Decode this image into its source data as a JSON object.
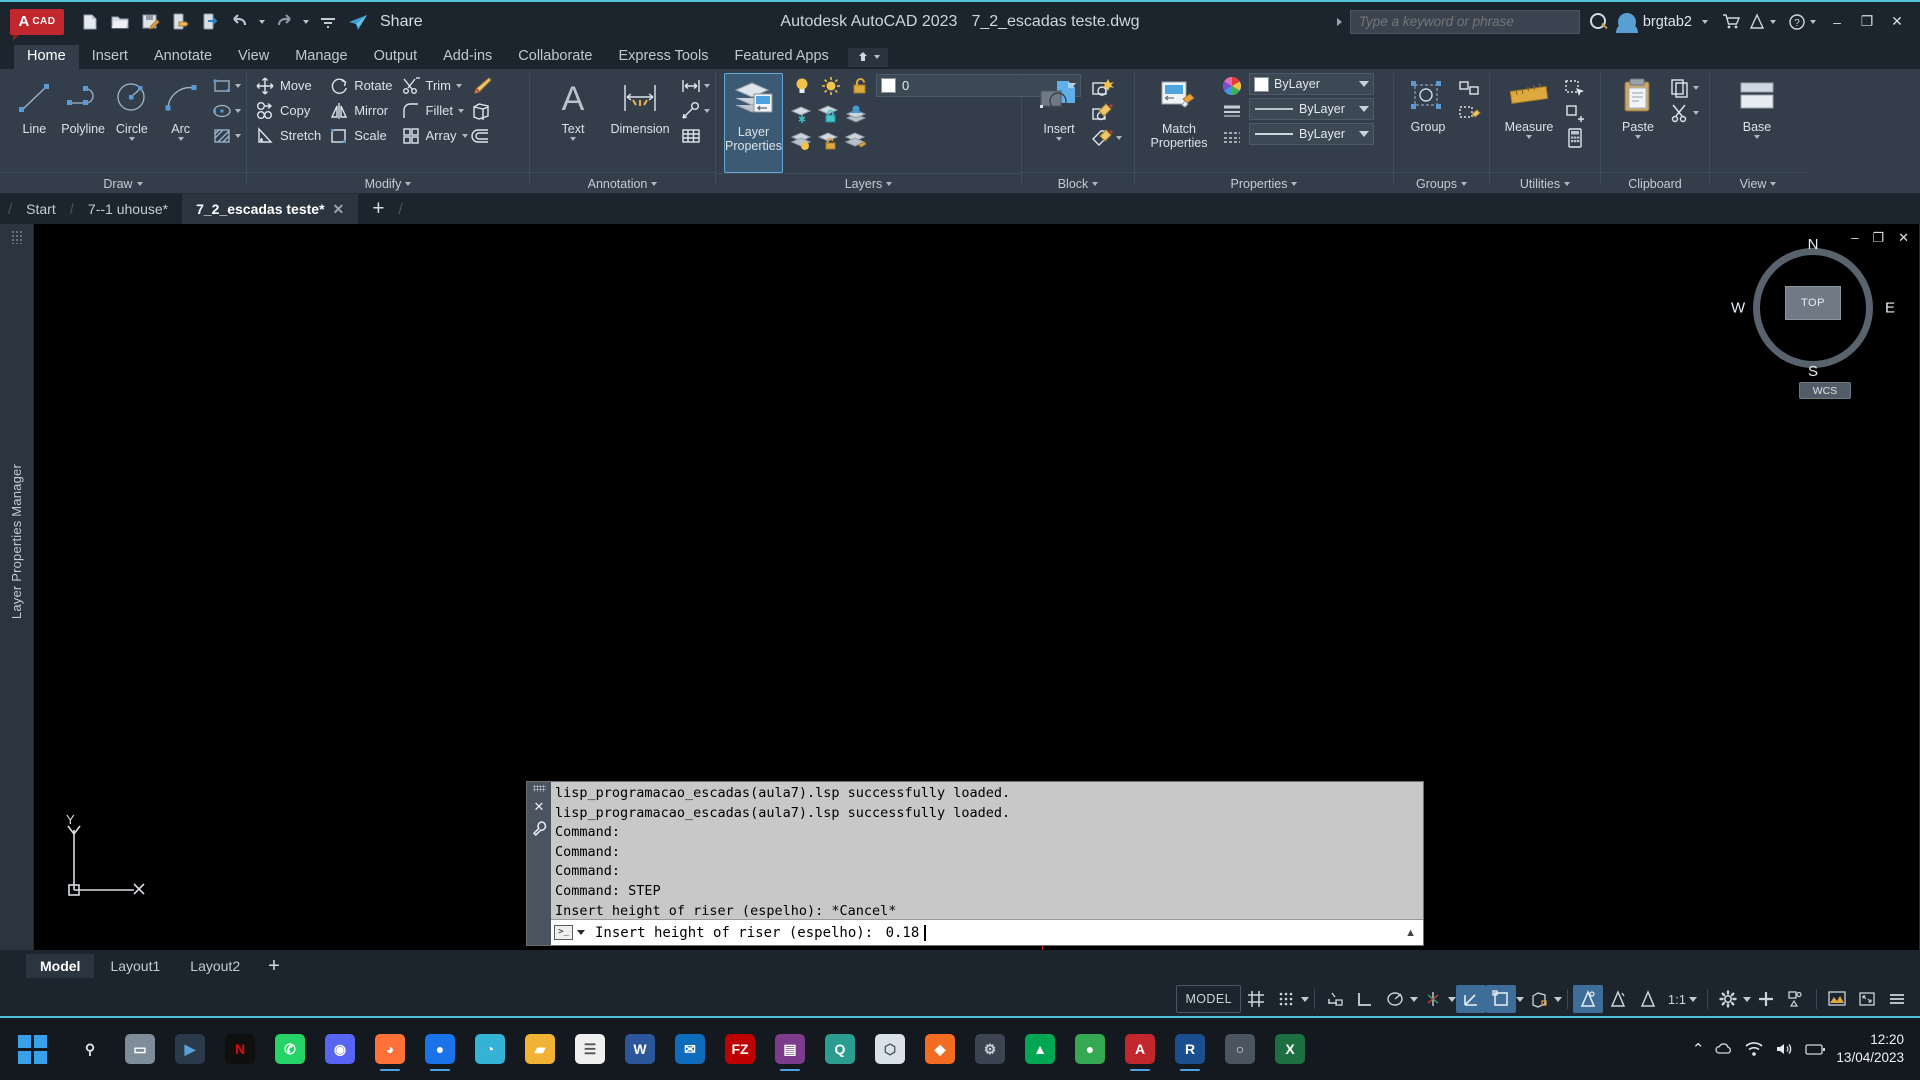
{
  "titlebar": {
    "logo_a": "A",
    "logo_cad": "CAD",
    "share_label": "Share",
    "app_title": "Autodesk AutoCAD 2023",
    "document_name": "7_2_escadas teste.dwg",
    "search_placeholder": "Type a keyword or phrase",
    "search_value": "",
    "user_name": "brgtab2",
    "quick_access": [
      "new-icon",
      "open-icon",
      "save-icon",
      "saveas-icon",
      "plot-icon",
      "undo-icon",
      "redo-icon",
      "customize-icon",
      "share-icon"
    ],
    "window_buttons": {
      "minimize": "–",
      "maximize": "❐",
      "close": "✕"
    }
  },
  "ribbon_tabs": [
    {
      "label": "Home",
      "active": true
    },
    {
      "label": "Insert",
      "active": false
    },
    {
      "label": "Annotate",
      "active": false
    },
    {
      "label": "View",
      "active": false
    },
    {
      "label": "Manage",
      "active": false
    },
    {
      "label": "Output",
      "active": false
    },
    {
      "label": "Add-ins",
      "active": false
    },
    {
      "label": "Collaborate",
      "active": false
    },
    {
      "label": "Express Tools",
      "active": false
    },
    {
      "label": "Featured Apps",
      "active": false
    }
  ],
  "ribbon": {
    "panels": [
      {
        "title": "Draw",
        "big_buttons": [
          {
            "label": "Line",
            "icon": "line-icon",
            "dropdown": false
          },
          {
            "label": "Polyline",
            "icon": "polyline-icon",
            "dropdown": false
          },
          {
            "label": "Circle",
            "icon": "circle-icon",
            "dropdown": true
          },
          {
            "label": "Arc",
            "icon": "arc-icon",
            "dropdown": true
          }
        ],
        "stack_buttons": [
          {
            "label": "",
            "icon": "rectangle-icon",
            "dropdown": true
          },
          {
            "label": "",
            "icon": "ellipse-icon",
            "dropdown": true
          },
          {
            "label": "",
            "icon": "hatch-icon",
            "dropdown": true
          }
        ]
      },
      {
        "title": "Modify",
        "rows": [
          [
            {
              "label": "Move",
              "icon": "move-icon"
            },
            {
              "label": "Rotate",
              "icon": "rotate-icon"
            },
            {
              "label": "Trim",
              "icon": "trim-icon",
              "dropdown": true
            },
            {
              "label": "",
              "icon": "erase-icon"
            }
          ],
          [
            {
              "label": "Copy",
              "icon": "copy-icon"
            },
            {
              "label": "Mirror",
              "icon": "mirror-icon"
            },
            {
              "label": "Fillet",
              "icon": "fillet-icon",
              "dropdown": true
            },
            {
              "label": "",
              "icon": "extrude-icon"
            }
          ],
          [
            {
              "label": "Stretch",
              "icon": "stretch-icon"
            },
            {
              "label": "Scale",
              "icon": "scale-icon"
            },
            {
              "label": "Array",
              "icon": "array-icon",
              "dropdown": true
            },
            {
              "label": "",
              "icon": "offset-icon"
            }
          ]
        ]
      },
      {
        "title": "Annotation",
        "big_buttons": [
          {
            "label": "Text",
            "icon": "text-icon",
            "dropdown": true
          },
          {
            "label": "Dimension",
            "icon": "dimension-icon",
            "dropdown": false
          }
        ],
        "stack_buttons": [
          {
            "label": "",
            "icon": "dim-style-icon",
            "dropdown": true
          },
          {
            "label": "",
            "icon": "leader-icon",
            "dropdown": true
          },
          {
            "label": "",
            "icon": "table-icon",
            "dropdown": false
          }
        ]
      },
      {
        "title": "Layers",
        "big_buttons": [
          {
            "label": "Layer Properties",
            "icon": "layer-properties-icon",
            "active": true
          }
        ],
        "layer_combo": {
          "value": "0",
          "color_swatch": "#ffffff",
          "state_icons": [
            "lightbulb-on-icon",
            "sun-icon",
            "unlock-icon"
          ]
        },
        "tool_icons": [
          "layer-freeze-icon",
          "layer-lock-icon",
          "layer-isolate-icon",
          "layer-off-icon",
          "layer-unlock-icon",
          "layer-match-icon",
          "layer-previous-icon",
          "layer-merge-icon",
          "layer-delete-icon"
        ]
      },
      {
        "title": "Block",
        "big_buttons": [
          {
            "label": "Insert",
            "icon": "insert-block-icon",
            "dropdown": true
          }
        ],
        "tool_icons": [
          "create-block-icon",
          "edit-block-icon",
          "edit-attribute-icon"
        ]
      },
      {
        "title": "Properties",
        "big_buttons": [
          {
            "label": "Match Properties",
            "icon": "match-properties-icon"
          }
        ],
        "combos": [
          {
            "label": "ByLayer",
            "type": "color",
            "swatch": "#ffffff"
          },
          {
            "label": "ByLayer",
            "type": "linetype"
          },
          {
            "label": "ByLayer",
            "type": "lineweight"
          }
        ]
      },
      {
        "title": "Groups",
        "big_buttons": [
          {
            "label": "Group",
            "icon": "group-icon"
          }
        ],
        "tool_icons": [
          "ungroup-icon",
          "group-edit-icon"
        ]
      },
      {
        "title": "Utilities",
        "big_buttons": [
          {
            "label": "Measure",
            "icon": "measure-icon",
            "dropdown": true
          }
        ],
        "tool_icons": [
          "quick-select-icon",
          "id-point-icon",
          "calculator-icon"
        ]
      },
      {
        "title": "Clipboard",
        "big_buttons": [
          {
            "label": "Paste",
            "icon": "paste-icon",
            "dropdown": true
          }
        ],
        "tool_icons": [
          "copy-clip-icon",
          "cut-clip-icon"
        ]
      },
      {
        "title": "View",
        "big_buttons": [
          {
            "label": "Base",
            "icon": "base-view-icon",
            "dropdown": true
          }
        ]
      }
    ]
  },
  "file_tabs": [
    {
      "label": "Start",
      "active": false,
      "closable": false
    },
    {
      "label": "7--1 uhouse*",
      "active": false,
      "closable": false
    },
    {
      "label": "7_2_escadas teste*",
      "active": true,
      "closable": true
    }
  ],
  "file_tabs_add": "+",
  "left_rail": {
    "label": "Layer Properties Manager"
  },
  "viewport": {
    "window_buttons": {
      "minimize": "–",
      "restore": "❐",
      "close": "✕"
    },
    "viewcube": {
      "top": "TOP",
      "north": "N",
      "south": "S",
      "west": "W",
      "east": "E"
    },
    "wcs_label": "WCS",
    "ucs_labels": {
      "y": "Y",
      "x": "X"
    },
    "background": "#000000",
    "crosshair_color": "#d02020"
  },
  "command_window": {
    "history": [
      "lisp_programacao_escadas(aula7).lsp successfully loaded.",
      "lisp_programacao_escadas(aula7).lsp successfully loaded.",
      "Command:",
      "Command:",
      "Command:",
      "Command: STEP",
      " Insert height of riser (espelho): *Cancel*"
    ],
    "input_prompt": "Insert height of riser (espelho): ",
    "input_value": "0.18",
    "close_icon": "close-icon",
    "settings_icon": "wrench-icon"
  },
  "layout_tabs": [
    {
      "label": "Model",
      "active": true
    },
    {
      "label": "Layout1",
      "active": false
    },
    {
      "label": "Layout2",
      "active": false
    }
  ],
  "layout_add": "+",
  "status_bar": {
    "model_label": "MODEL",
    "scale_label": "1:1",
    "items": [
      {
        "name": "grid-display-toggle",
        "icon": "grid-icon",
        "on": false
      },
      {
        "name": "snap-mode-toggle",
        "icon": "snap-icon",
        "on": false,
        "dropdown": true
      },
      {
        "name": "infer-constraints-toggle",
        "icon": "infer-icon",
        "on": false
      },
      {
        "name": "ortho-mode-toggle",
        "icon": "ortho-icon",
        "on": false
      },
      {
        "name": "polar-tracking-toggle",
        "icon": "polar-icon",
        "on": false,
        "dropdown": true
      },
      {
        "name": "isometric-drafting-toggle",
        "icon": "isodraft-icon",
        "on": false,
        "dropdown": true
      },
      {
        "name": "object-snap-tracking-toggle",
        "icon": "osnap-track-icon",
        "on": true
      },
      {
        "name": "object-snap-toggle",
        "icon": "osnap-icon",
        "on": true,
        "dropdown": true
      },
      {
        "name": "3d-object-snap-toggle",
        "icon": "osnap3d-icon",
        "on": false,
        "dropdown": true
      },
      {
        "name": "dynamic-ucs-toggle",
        "icon": "dynamic-ucs-icon",
        "on": true
      },
      {
        "name": "selection-cycling-toggle",
        "icon": "selection-cycling-icon",
        "on": false
      },
      {
        "name": "annotation-visibility-toggle",
        "icon": "annotation-visibility-icon",
        "on": false
      },
      {
        "name": "annotation-scale-menu",
        "icon": "scale-icon",
        "on": false,
        "dropdown": true
      },
      {
        "name": "workspace-switching-button",
        "icon": "gear-icon",
        "on": false,
        "dropdown": true
      },
      {
        "name": "customization-button",
        "icon": "plus-icon",
        "on": false
      },
      {
        "name": "isolate-objects-button",
        "icon": "isolate-objects-icon",
        "on": false
      },
      {
        "name": "graphics-performance-button",
        "icon": "graphics-performance-icon",
        "on": false
      },
      {
        "name": "clean-screen-button",
        "icon": "clean-screen-icon",
        "on": false
      },
      {
        "name": "status-menu-button",
        "icon": "hamburger-icon",
        "on": false
      }
    ]
  },
  "taskbar": {
    "start_icon": "windows-start-icon",
    "apps": [
      {
        "name": "search-taskbar-icon",
        "glyph": "⚲",
        "color": "transparent",
        "text": "#dfe5ec",
        "active": false
      },
      {
        "name": "task-view-icon",
        "glyph": "▭",
        "color": "#7f8c99",
        "text": "#fff",
        "active": false
      },
      {
        "name": "netflix-alt-icon",
        "glyph": "▶",
        "color": "#2b3a4a",
        "text": "#5aa0d8",
        "active": false
      },
      {
        "name": "netflix-icon",
        "glyph": "N",
        "color": "#0f0f0f",
        "text": "#e50914",
        "active": false
      },
      {
        "name": "whatsapp-icon",
        "glyph": "✆",
        "color": "#25d366",
        "text": "#fff",
        "active": false
      },
      {
        "name": "discord-icon",
        "glyph": "◉",
        "color": "#5865f2",
        "text": "#fff",
        "active": false
      },
      {
        "name": "firefox-icon",
        "glyph": "◕",
        "color": "#ff7139",
        "text": "#fff",
        "active": true
      },
      {
        "name": "chrome-icon",
        "glyph": "●",
        "color": "#1a73e8",
        "text": "#fff",
        "active": true
      },
      {
        "name": "edge-icon",
        "glyph": "◔",
        "color": "#35b3d6",
        "text": "#fff",
        "active": false
      },
      {
        "name": "file-explorer-icon",
        "glyph": "▰",
        "color": "#f2b233",
        "text": "#fff",
        "active": false
      },
      {
        "name": "notepad-icon",
        "glyph": "☰",
        "color": "#f0f0f0",
        "text": "#555",
        "active": false
      },
      {
        "name": "word-icon",
        "glyph": "W",
        "color": "#2b579a",
        "text": "#fff",
        "active": false
      },
      {
        "name": "outlook-icon",
        "glyph": "✉",
        "color": "#0f6cbd",
        "text": "#fff",
        "active": false
      },
      {
        "name": "filezilla-icon",
        "glyph": "FZ",
        "color": "#bf0000",
        "text": "#fff",
        "active": false
      },
      {
        "name": "winrar-icon",
        "glyph": "▤",
        "color": "#7d3b8c",
        "text": "#fff",
        "active": true
      },
      {
        "name": "qbittorrent-icon",
        "glyph": "Q",
        "color": "#2a9d8f",
        "text": "#fff",
        "active": false
      },
      {
        "name": "sketchup-icon",
        "glyph": "⬡",
        "color": "#d9e2e9",
        "text": "#4a5560",
        "active": false
      },
      {
        "name": "photoshop-icon",
        "glyph": "◆",
        "color": "#f26d21",
        "text": "#fff",
        "active": false
      },
      {
        "name": "app-dark-icon",
        "glyph": "⚙",
        "color": "#3b4450",
        "text": "#c8d0d8",
        "active": false
      },
      {
        "name": "lumion-icon",
        "glyph": "▲",
        "color": "#00a651",
        "text": "#fff",
        "active": false
      },
      {
        "name": "chrome-alt-icon",
        "glyph": "●",
        "color": "#34a853",
        "text": "#fff",
        "active": false
      },
      {
        "name": "autocad-icon",
        "glyph": "A",
        "color": "#c1272d",
        "text": "#fff",
        "active": true
      },
      {
        "name": "revit-icon",
        "glyph": "R",
        "color": "#1b4e8f",
        "text": "#fff",
        "active": true
      },
      {
        "name": "pro-app-icon",
        "glyph": "○",
        "color": "#4a5560",
        "text": "#dfe5ec",
        "active": false
      },
      {
        "name": "excel-icon",
        "glyph": "X",
        "color": "#1d6f42",
        "text": "#fff",
        "active": false
      }
    ],
    "tray": {
      "chevron": "⌃",
      "icons": [
        "cloud-sync-icon",
        "wifi-icon",
        "volume-icon",
        "battery-icon"
      ],
      "time": "12:20",
      "date": "13/04/2023"
    }
  }
}
